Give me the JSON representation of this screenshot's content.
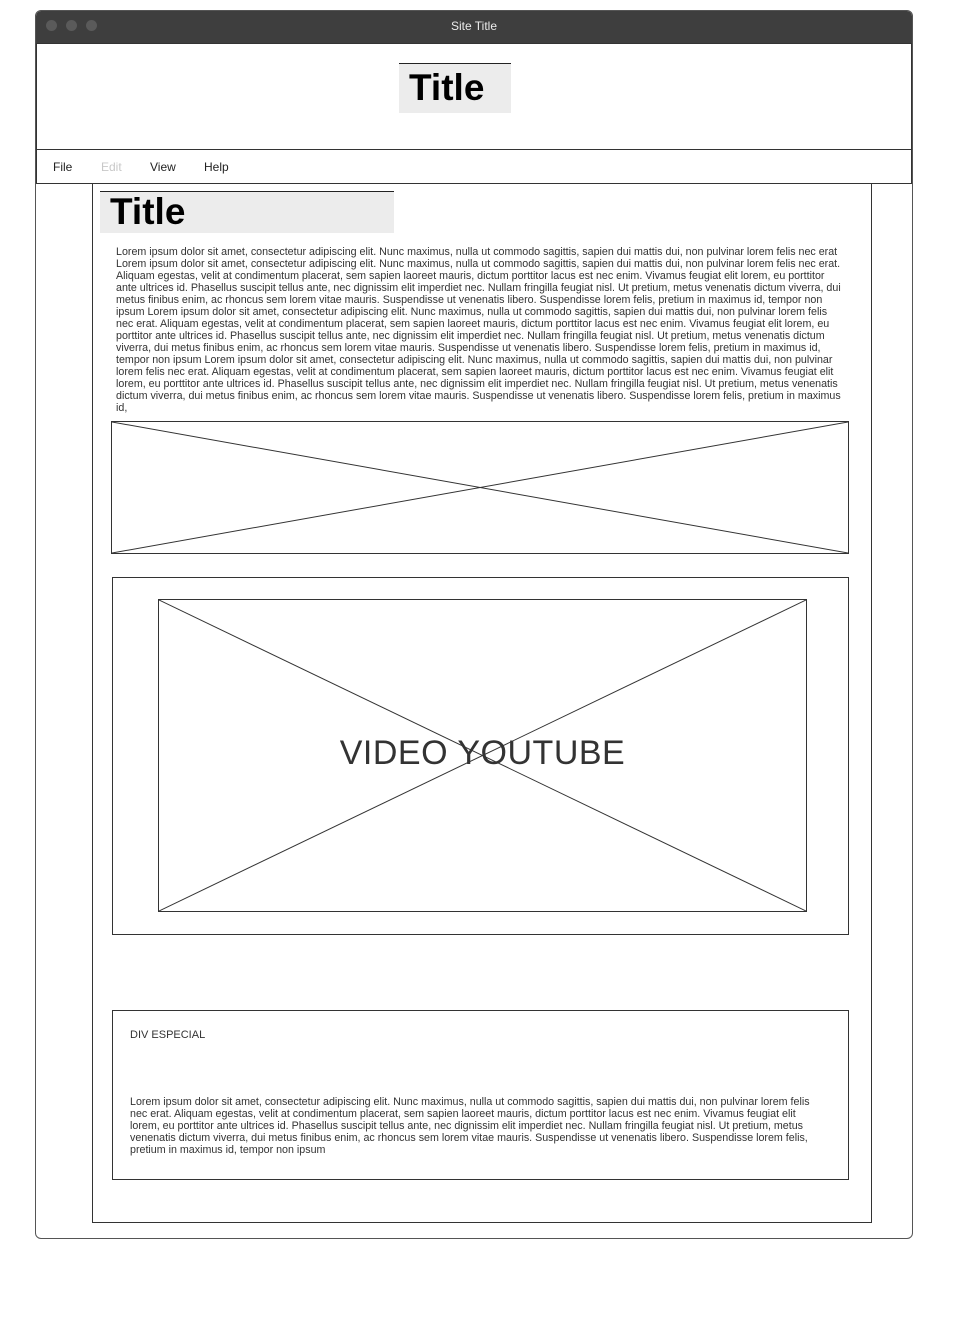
{
  "window": {
    "site_title": "Site Title"
  },
  "header": {
    "title": "Title"
  },
  "menu": [
    {
      "label": "File",
      "enabled": true
    },
    {
      "label": "Edit",
      "enabled": false
    },
    {
      "label": "View",
      "enabled": true
    },
    {
      "label": "Help",
      "enabled": true
    }
  ],
  "content": {
    "title": "Title",
    "paragraph": "Lorem ipsum dolor sit amet, consectetur adipiscing elit. Nunc maximus, nulla ut commodo sagittis, sapien dui mattis dui, non pulvinar lorem felis nec erat Lorem ipsum dolor sit amet, consectetur adipiscing elit. Nunc maximus, nulla ut commodo sagittis, sapien dui mattis dui, non pulvinar lorem felis nec erat. Aliquam egestas, velit at condimentum placerat, sem sapien laoreet mauris, dictum porttitor lacus est nec enim. Vivamus feugiat elit lorem, eu porttitor ante ultrices id. Phasellus suscipit tellus ante, nec dignissim elit imperdiet nec. Nullam fringilla feugiat nisl. Ut pretium, metus venenatis dictum viverra, dui metus finibus enim, ac rhoncus sem lorem vitae mauris. Suspendisse ut venenatis libero. Suspendisse lorem felis, pretium in maximus id, tempor non ipsum Lorem ipsum dolor sit amet, consectetur adipiscing elit. Nunc maximus, nulla ut commodo sagittis, sapien dui mattis dui, non pulvinar lorem felis nec erat. Aliquam egestas, velit at condimentum placerat, sem sapien laoreet mauris, dictum porttitor lacus est nec enim. Vivamus feugiat elit lorem, eu porttitor ante ultrices id. Phasellus suscipit tellus ante, nec dignissim elit imperdiet nec. Nullam fringilla feugiat nisl. Ut pretium, metus venenatis dictum viverra, dui metus finibus enim, ac rhoncus sem lorem vitae mauris. Suspendisse ut venenatis libero. Suspendisse lorem felis, pretium in maximus id, tempor non ipsum Lorem ipsum dolor sit amet, consectetur adipiscing elit. Nunc maximus, nulla ut commodo sagittis, sapien dui mattis dui, non pulvinar lorem felis nec erat. Aliquam egestas, velit at condimentum placerat, sem sapien laoreet mauris, dictum porttitor lacus est nec enim. Vivamus feugiat elit lorem, eu porttitor ante ultrices id. Phasellus suscipit tellus ante, nec dignissim elit imperdiet nec. Nullam fringilla feugiat nisl. Ut pretium, metus venenatis dictum viverra, dui metus finibus enim, ac rhoncus sem lorem vitae mauris. Suspendisse ut venenatis libero. Suspendisse lorem felis, pretium in maximus id,",
    "video_label": "VIDEO YOUTUBE",
    "special": {
      "label": "DIV ESPECIAL",
      "paragraph": "Lorem ipsum dolor sit amet, consectetur adipiscing elit. Nunc maximus, nulla ut commodo sagittis, sapien dui mattis dui, non pulvinar lorem felis nec erat. Aliquam egestas, velit at condimentum placerat, sem sapien laoreet mauris, dictum porttitor lacus est nec enim. Vivamus feugiat elit lorem, eu porttitor ante ultrices id. Phasellus suscipit tellus ante, nec dignissim elit imperdiet nec. Nullam fringilla feugiat nisl. Ut pretium, metus venenatis dictum viverra, dui metus finibus enim, ac rhoncus sem lorem vitae mauris. Suspendisse ut venenatis libero. Suspendisse lorem felis, pretium in maximus id, tempor non ipsum"
    }
  },
  "colors": {
    "titlebar": "#3e3e3e",
    "title_highlight": "#ececec",
    "disabled_text": "#c8c8c8"
  }
}
